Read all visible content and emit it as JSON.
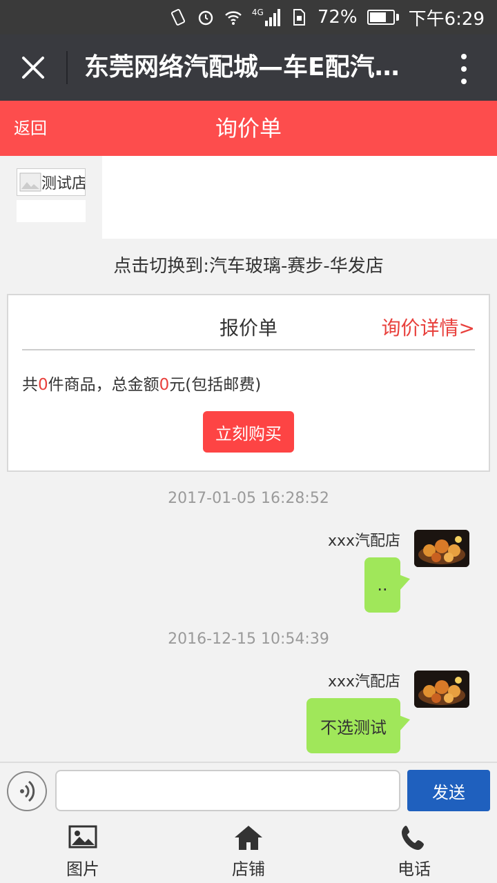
{
  "status_bar": {
    "network": "4G",
    "battery_percent": "72%",
    "battery_level": 0.72,
    "time": "下午6:29"
  },
  "window": {
    "title": "东莞网络汽配城—车E配汽配..."
  },
  "header": {
    "back_label": "返回",
    "title": "询价单"
  },
  "shop_tab": {
    "label": "测试店"
  },
  "switch_text": "点击切换到:汽车玻璃-赛步-华发店",
  "quote_card": {
    "title": "报价单",
    "detail_link": "询价详情>",
    "summary_prefix": "共",
    "item_count": "0",
    "summary_mid": "件商品，总金额",
    "total_amount": "0",
    "summary_suffix": "元(包括邮费)",
    "buy_button": "立刻购买"
  },
  "messages": [
    {
      "timestamp": "2017-01-05 16:28:52",
      "sender": "xxx汽配店",
      "text": ".."
    },
    {
      "timestamp": "2016-12-15 10:54:39",
      "sender": "xxx汽配店",
      "text": "不选测试"
    }
  ],
  "input_bar": {
    "value": "",
    "send_label": "发送"
  },
  "tab_bar": {
    "items": [
      {
        "label": "图片",
        "icon": "image-icon"
      },
      {
        "label": "店铺",
        "icon": "home-icon"
      },
      {
        "label": "电话",
        "icon": "phone-icon"
      }
    ]
  },
  "colors": {
    "header_red": "#fd4d4d",
    "titlebar": "#393a3f",
    "bubble_green": "#a0e75a",
    "send_blue": "#1f60be",
    "accent_red": "#e8403c"
  }
}
